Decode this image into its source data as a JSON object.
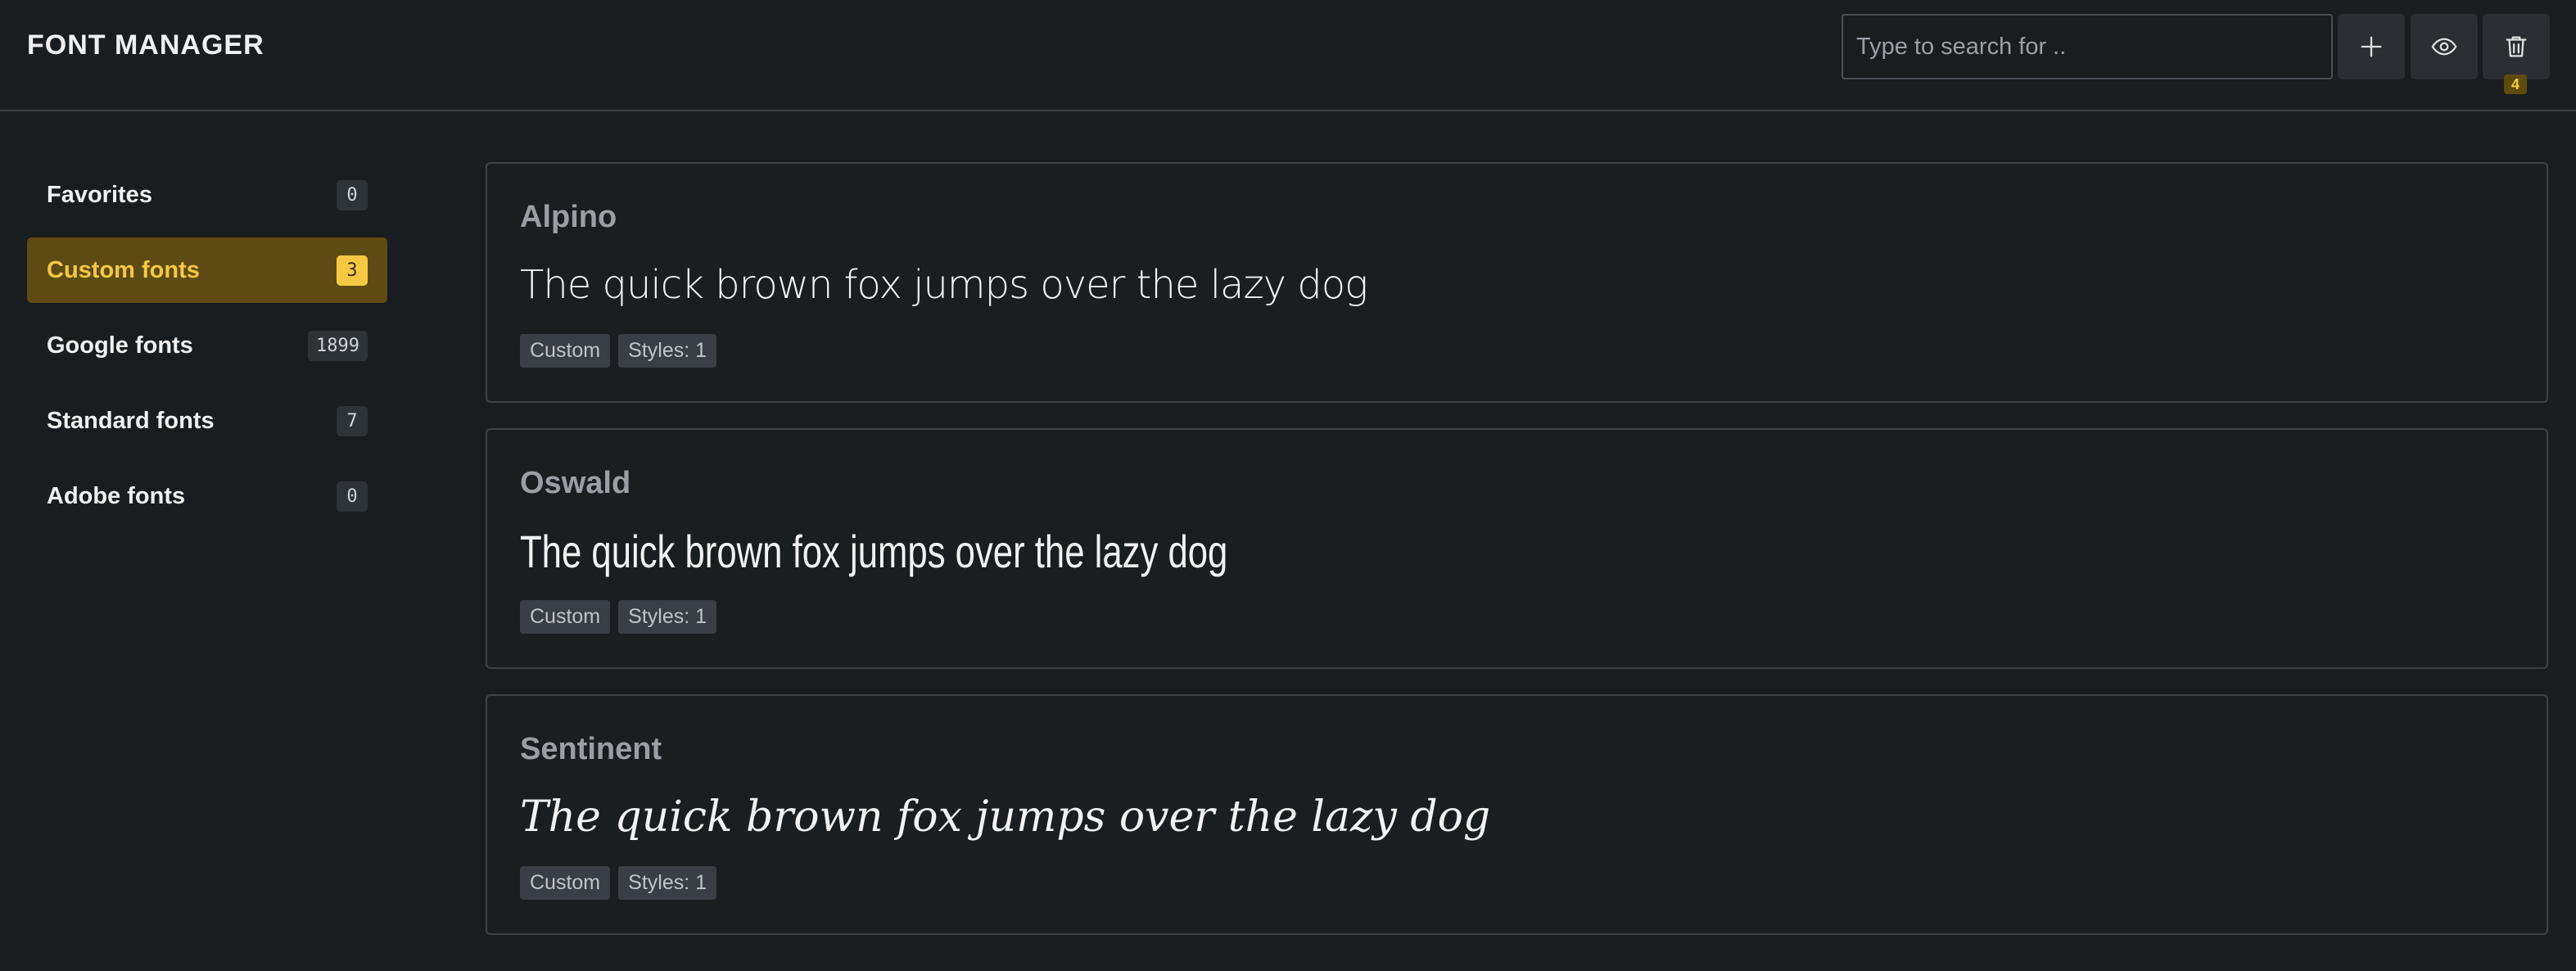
{
  "header": {
    "title": "FONT MANAGER",
    "search_placeholder": "Type to search for ..",
    "trash_count": "4"
  },
  "sidebar": {
    "items": [
      {
        "label": "Favorites",
        "count": "0"
      },
      {
        "label": "Custom fonts",
        "count": "3"
      },
      {
        "label": "Google fonts",
        "count": "1899"
      },
      {
        "label": "Standard fonts",
        "count": "7"
      },
      {
        "label": "Adobe fonts",
        "count": "0"
      }
    ]
  },
  "fonts": [
    {
      "name": "Alpino",
      "preview": "The quick brown fox jumps over the lazy dog",
      "tag_type": "Custom",
      "tag_styles": "Styles: 1"
    },
    {
      "name": "Oswald",
      "preview": "The quick brown fox jumps over the lazy dog",
      "tag_type": "Custom",
      "tag_styles": "Styles: 1"
    },
    {
      "name": "Sentinent",
      "preview": "The quick brown fox jumps over the lazy dog",
      "tag_type": "Custom",
      "tag_styles": "Styles: 1"
    }
  ],
  "colors": {
    "accent": "#f5c842",
    "active_bg": "#5e4b13",
    "background": "#1a1d20"
  },
  "icons": [
    "plus-icon",
    "eye-icon",
    "trash-icon"
  ]
}
